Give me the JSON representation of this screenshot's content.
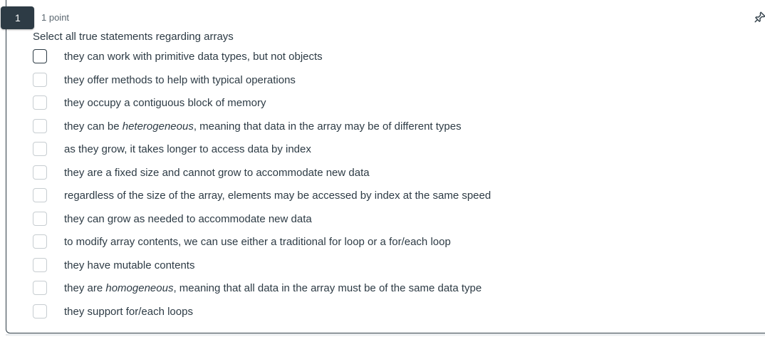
{
  "question": {
    "number": "1",
    "points": "1 point",
    "prompt": "Select all true statements regarding arrays"
  },
  "options": [
    {
      "pre": "they can work with primitive data types, but not objects",
      "em": "",
      "post": "",
      "checked": false
    },
    {
      "pre": "they offer methods to help with typical operations",
      "em": "",
      "post": "",
      "checked": false
    },
    {
      "pre": "they occupy a contiguous block of memory",
      "em": "",
      "post": "",
      "checked": false
    },
    {
      "pre": "they can be ",
      "em": "heterogeneous",
      "post": ", meaning that data in the array may be of different types",
      "checked": false
    },
    {
      "pre": "as they grow, it takes longer to access data by index",
      "em": "",
      "post": "",
      "checked": false
    },
    {
      "pre": "they are a fixed size and cannot grow to accommodate new data",
      "em": "",
      "post": "",
      "checked": false
    },
    {
      "pre": "regardless of the size of the array, elements may be accessed by index at the same speed",
      "em": "",
      "post": "",
      "checked": false
    },
    {
      "pre": "they can grow as needed to accommodate new data",
      "em": "",
      "post": "",
      "checked": false
    },
    {
      "pre": "to modify array contents, we can use either a traditional for loop or a for/each loop",
      "em": "",
      "post": "",
      "checked": false
    },
    {
      "pre": "they have mutable contents",
      "em": "",
      "post": "",
      "checked": false
    },
    {
      "pre": "they are ",
      "em": "homogeneous",
      "post": ", meaning that all data in the array must be of the same data type",
      "checked": false
    },
    {
      "pre": "they support for/each loops",
      "em": "",
      "post": "",
      "checked": false
    }
  ],
  "icons": {
    "pin": "pin-icon"
  },
  "colors": {
    "text": "#2d3b45",
    "badge": "#2d3b45",
    "checkbox_border": "#c7cdd1"
  }
}
